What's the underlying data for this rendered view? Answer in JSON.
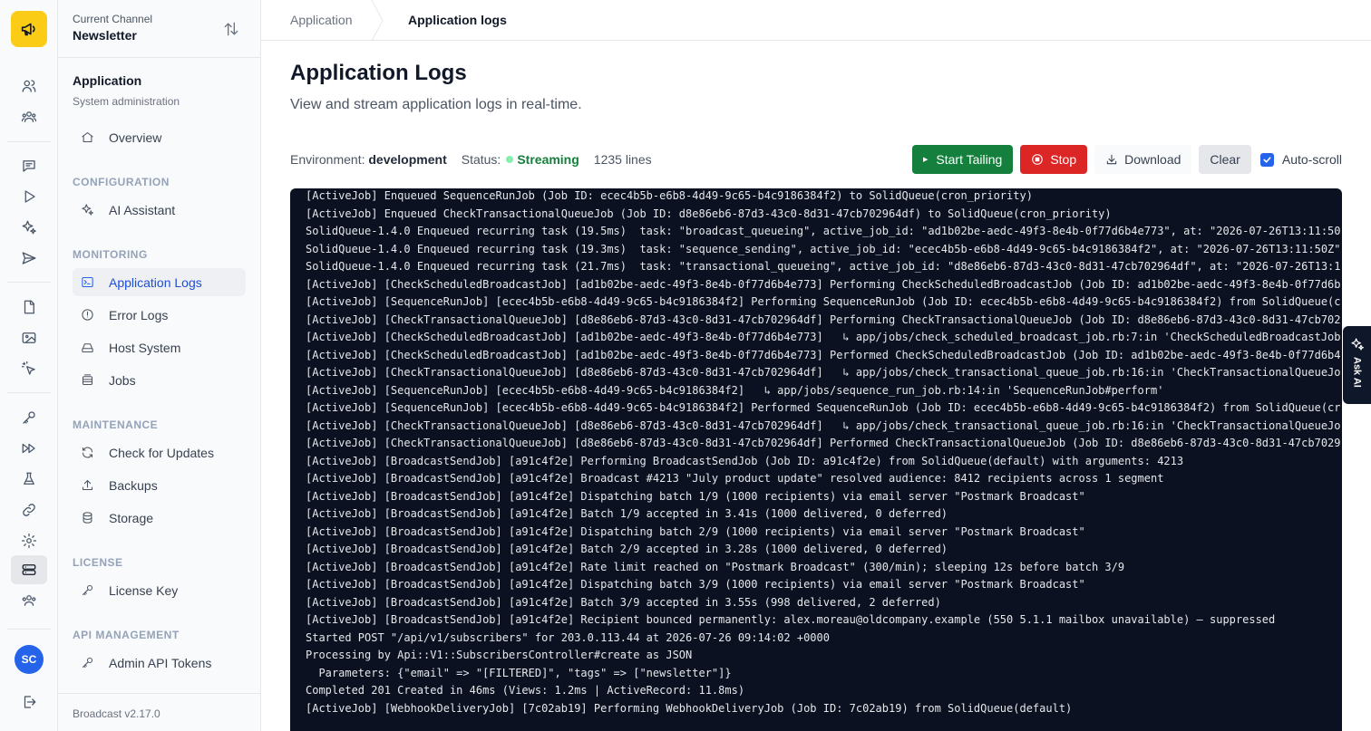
{
  "channel": {
    "label": "Current Channel",
    "name": "Newsletter"
  },
  "section": {
    "title": "Application",
    "subtitle": "System administration"
  },
  "nav": {
    "overview": "Overview",
    "groups": {
      "configuration": "CONFIGURATION",
      "monitoring": "MONITORING",
      "maintenance": "MAINTENANCE",
      "license": "LICENSE",
      "api": "API MANAGEMENT"
    },
    "items": {
      "ai_assistant": "AI Assistant",
      "application_logs": "Application Logs",
      "error_logs": "Error Logs",
      "host_system": "Host System",
      "jobs": "Jobs",
      "check_updates": "Check for Updates",
      "backups": "Backups",
      "storage": "Storage",
      "license_key": "License Key",
      "admin_api_tokens": "Admin API Tokens"
    }
  },
  "version": "Broadcast v2.17.0",
  "user": {
    "initials": "SC"
  },
  "breadcrumb": {
    "parent": "Application",
    "current": "Application logs"
  },
  "page": {
    "title": "Application Logs",
    "subtitle": "View and stream application logs in real-time."
  },
  "status": {
    "env_label": "Environment:",
    "env_value": "development",
    "status_label": "Status:",
    "status_value": "Streaming",
    "lines": "1235 lines",
    "streaming_color": "#15803d"
  },
  "toolbar": {
    "start": "Start Tailing",
    "stop": "Stop",
    "download": "Download",
    "clear": "Clear",
    "autoscroll": "Auto-scroll",
    "autoscroll_checked": true
  },
  "ask_ai": "Ask AI",
  "logs": [
    "[ActiveJob] Enqueued SequenceRunJob (Job ID: ecec4b5b-e6b8-4d49-9c65-b4c9186384f2) to SolidQueue(cron_priority)",
    "[ActiveJob] Enqueued CheckTransactionalQueueJob (Job ID: d8e86eb6-87d3-43c0-8d31-47cb702964df) to SolidQueue(cron_priority)",
    "SolidQueue-1.4.0 Enqueued recurring task (19.5ms)  task: \"broadcast_queueing\", active_job_id: \"ad1b02be-aedc-49f3-8e4b-0f77d6b4e773\", at: \"2026-07-26T13:11:50",
    "SolidQueue-1.4.0 Enqueued recurring task (19.3ms)  task: \"sequence_sending\", active_job_id: \"ecec4b5b-e6b8-4d49-9c65-b4c9186384f2\", at: \"2026-07-26T13:11:50Z\"",
    "SolidQueue-1.4.0 Enqueued recurring task (21.7ms)  task: \"transactional_queueing\", active_job_id: \"d8e86eb6-87d3-43c0-8d31-47cb702964df\", at: \"2026-07-26T13:1",
    "[ActiveJob] [CheckScheduledBroadcastJob] [ad1b02be-aedc-49f3-8e4b-0f77d6b4e773] Performing CheckScheduledBroadcastJob (Job ID: ad1b02be-aedc-49f3-8e4b-0f77d6b",
    "[ActiveJob] [SequenceRunJob] [ecec4b5b-e6b8-4d49-9c65-b4c9186384f2] Performing SequenceRunJob (Job ID: ecec4b5b-e6b8-4d49-9c65-b4c9186384f2) from SolidQueue(c",
    "[ActiveJob] [CheckTransactionalQueueJob] [d8e86eb6-87d3-43c0-8d31-47cb702964df] Performing CheckTransactionalQueueJob (Job ID: d8e86eb6-87d3-43c0-8d31-47cb702",
    "[ActiveJob] [CheckScheduledBroadcastJob] [ad1b02be-aedc-49f3-8e4b-0f77d6b4e773]   ↳ app/jobs/check_scheduled_broadcast_job.rb:7:in 'CheckScheduledBroadcastJob",
    "[ActiveJob] [CheckScheduledBroadcastJob] [ad1b02be-aedc-49f3-8e4b-0f77d6b4e773] Performed CheckScheduledBroadcastJob (Job ID: ad1b02be-aedc-49f3-8e4b-0f77d6b4",
    "[ActiveJob] [CheckTransactionalQueueJob] [d8e86eb6-87d3-43c0-8d31-47cb702964df]   ↳ app/jobs/check_transactional_queue_job.rb:16:in 'CheckTransactionalQueueJo",
    "[ActiveJob] [SequenceRunJob] [ecec4b5b-e6b8-4d49-9c65-b4c9186384f2]   ↳ app/jobs/sequence_run_job.rb:14:in 'SequenceRunJob#perform'",
    "[ActiveJob] [SequenceRunJob] [ecec4b5b-e6b8-4d49-9c65-b4c9186384f2] Performed SequenceRunJob (Job ID: ecec4b5b-e6b8-4d49-9c65-b4c9186384f2) from SolidQueue(cr",
    "[ActiveJob] [CheckTransactionalQueueJob] [d8e86eb6-87d3-43c0-8d31-47cb702964df]   ↳ app/jobs/check_transactional_queue_job.rb:16:in 'CheckTransactionalQueueJo",
    "[ActiveJob] [CheckTransactionalQueueJob] [d8e86eb6-87d3-43c0-8d31-47cb702964df] Performed CheckTransactionalQueueJob (Job ID: d8e86eb6-87d3-43c0-8d31-47cb7029",
    "[ActiveJob] [BroadcastSendJob] [a91c4f2e] Performing BroadcastSendJob (Job ID: a91c4f2e) from SolidQueue(default) with arguments: 4213",
    "[ActiveJob] [BroadcastSendJob] [a91c4f2e] Broadcast #4213 \"July product update\" resolved audience: 8412 recipients across 1 segment",
    "[ActiveJob] [BroadcastSendJob] [a91c4f2e] Dispatching batch 1/9 (1000 recipients) via email server \"Postmark Broadcast\"",
    "[ActiveJob] [BroadcastSendJob] [a91c4f2e] Batch 1/9 accepted in 3.41s (1000 delivered, 0 deferred)",
    "[ActiveJob] [BroadcastSendJob] [a91c4f2e] Dispatching batch 2/9 (1000 recipients) via email server \"Postmark Broadcast\"",
    "[ActiveJob] [BroadcastSendJob] [a91c4f2e] Batch 2/9 accepted in 3.28s (1000 delivered, 0 deferred)",
    "[ActiveJob] [BroadcastSendJob] [a91c4f2e] Rate limit reached on \"Postmark Broadcast\" (300/min); sleeping 12s before batch 3/9",
    "[ActiveJob] [BroadcastSendJob] [a91c4f2e] Dispatching batch 3/9 (1000 recipients) via email server \"Postmark Broadcast\"",
    "[ActiveJob] [BroadcastSendJob] [a91c4f2e] Batch 3/9 accepted in 3.55s (998 delivered, 2 deferred)",
    "[ActiveJob] [BroadcastSendJob] [a91c4f2e] Recipient bounced permanently: alex.moreau@oldcompany.example (550 5.1.1 mailbox unavailable) — suppressed",
    "Started POST \"/api/v1/subscribers\" for 203.0.113.44 at 2026-07-26 09:14:02 +0000",
    "Processing by Api::V1::SubscribersController#create as JSON",
    "  Parameters: {\"email\" => \"[FILTERED]\", \"tags\" => [\"newsletter\"]}",
    "Completed 201 Created in 46ms (Views: 1.2ms | ActiveRecord: 11.8ms)",
    "[ActiveJob] [WebhookDeliveryJob] [7c02ab19] Performing WebhookDeliveryJob (Job ID: 7c02ab19) from SolidQueue(default)"
  ]
}
